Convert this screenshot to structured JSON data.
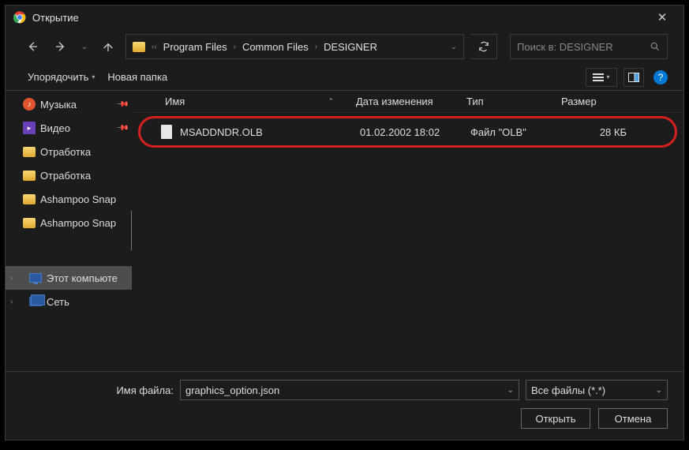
{
  "window": {
    "title": "Открытие"
  },
  "breadcrumbs": {
    "s0": "Program Files",
    "s1": "Common Files",
    "s2": "DESIGNER"
  },
  "search": {
    "placeholder": "Поиск в: DESIGNER"
  },
  "toolbar": {
    "organize": "Упорядочить",
    "newfolder": "Новая папка"
  },
  "sidebar": {
    "music": "Музыка",
    "video": "Видео",
    "otrabotka1": "Отработка",
    "otrabotka2": "Отработка",
    "ashampoo1": "Ashampoo Snap",
    "ashampoo2": "Ashampoo Snap",
    "computer": "Этот компьюте",
    "network": "Сеть"
  },
  "columns": {
    "name": "Имя",
    "date": "Дата изменения",
    "type": "Тип",
    "size": "Размер"
  },
  "file": {
    "name": "MSADDNDR.OLB",
    "date": "01.02.2002 18:02",
    "type": "Файл \"OLB\"",
    "size": "28 КБ"
  },
  "footer": {
    "filename_label": "Имя файла:",
    "filename_value": "graphics_option.json",
    "filter": "Все файлы (*.*)",
    "open": "Открыть",
    "cancel": "Отмена"
  }
}
